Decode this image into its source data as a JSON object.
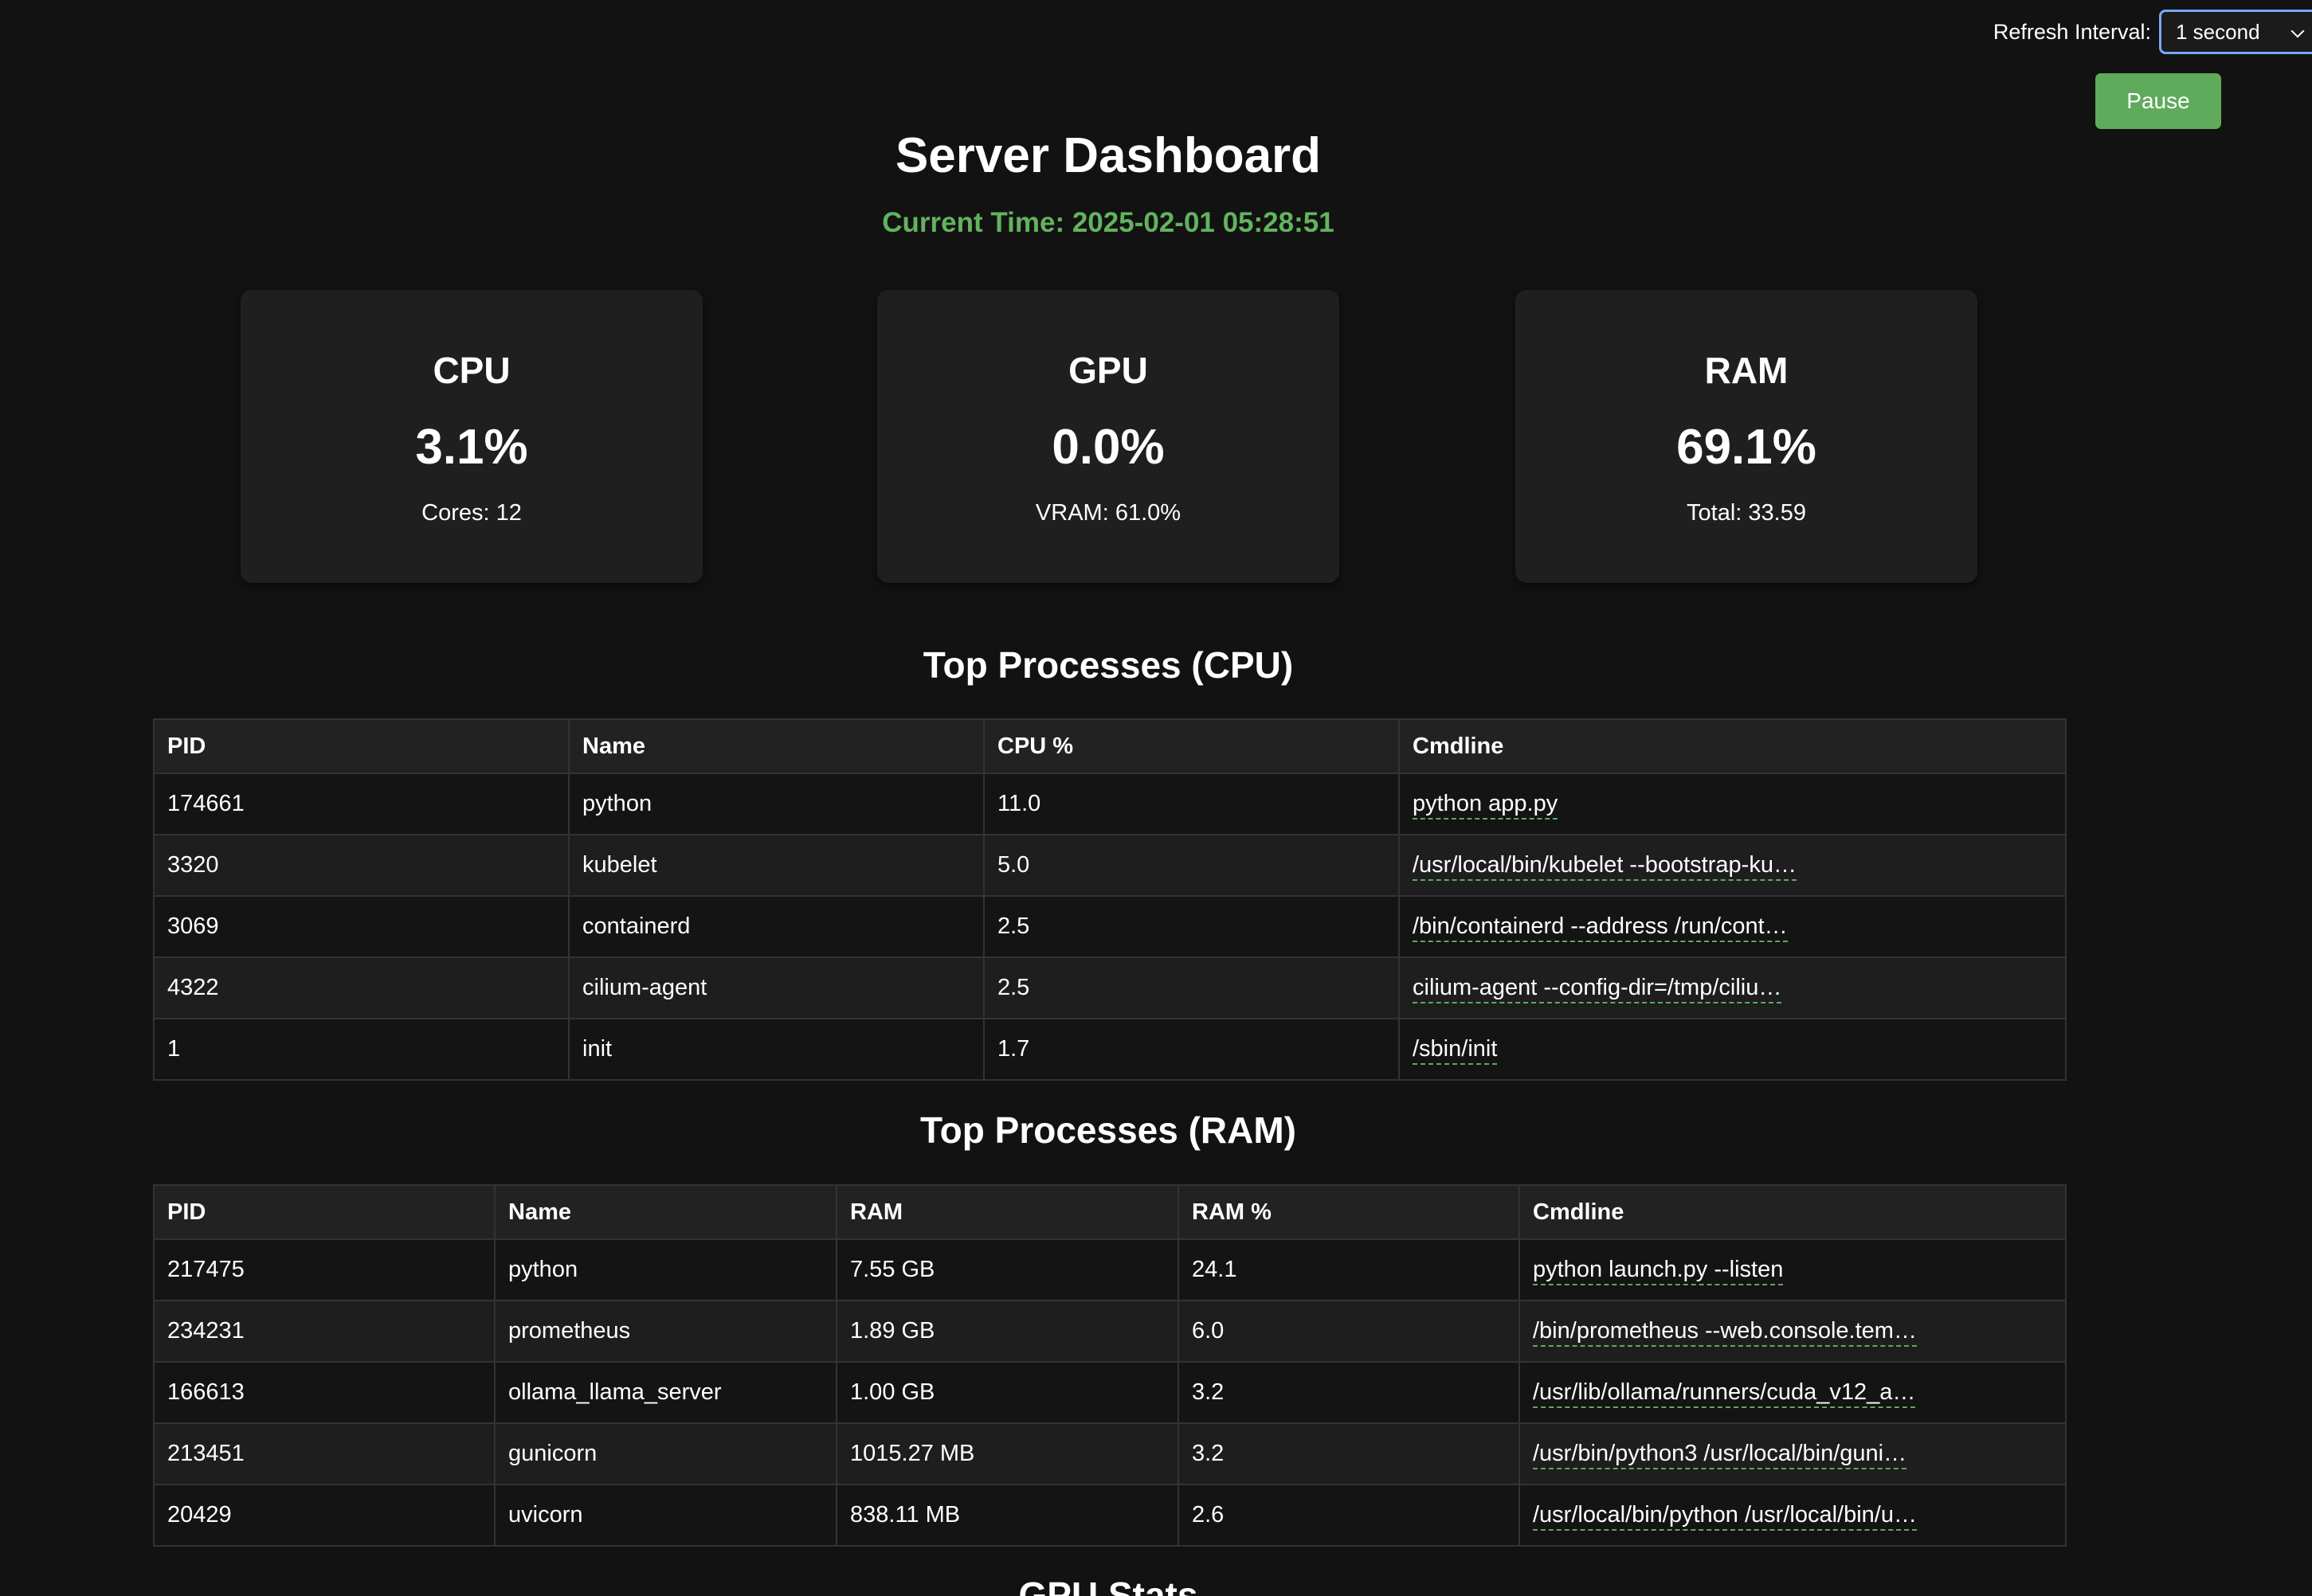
{
  "refresh": {
    "label": "Refresh Interval:",
    "selected": "1 second"
  },
  "pause_label": "Pause",
  "title": "Server Dashboard",
  "current_time": "Current Time: 2025-02-01 05:28:51",
  "cards": {
    "cpu": {
      "title": "CPU",
      "value": "3.1%",
      "sub": "Cores: 12"
    },
    "gpu": {
      "title": "GPU",
      "value": "0.0%",
      "sub": "VRAM: 61.0%"
    },
    "ram": {
      "title": "RAM",
      "value": "69.1%",
      "sub": "Total: 33.59"
    }
  },
  "cpu_table": {
    "title": "Top Processes (CPU)",
    "headers": [
      "PID",
      "Name",
      "CPU %",
      "Cmdline"
    ],
    "rows": [
      [
        "174661",
        "python",
        "11.0",
        "python app.py"
      ],
      [
        "3320",
        "kubelet",
        "5.0",
        "/usr/local/bin/kubelet --bootstrap-ku…"
      ],
      [
        "3069",
        "containerd",
        "2.5",
        "/bin/containerd --address /run/cont…"
      ],
      [
        "4322",
        "cilium-agent",
        "2.5",
        "cilium-agent --config-dir=/tmp/ciliu…"
      ],
      [
        "1",
        "init",
        "1.7",
        "/sbin/init"
      ]
    ]
  },
  "ram_table": {
    "title": "Top Processes (RAM)",
    "headers": [
      "PID",
      "Name",
      "RAM",
      "RAM %",
      "Cmdline"
    ],
    "rows": [
      [
        "217475",
        "python",
        "7.55 GB",
        "24.1",
        "python launch.py --listen"
      ],
      [
        "234231",
        "prometheus",
        "1.89 GB",
        "6.0",
        "/bin/prometheus --web.console.tem…"
      ],
      [
        "166613",
        "ollama_llama_server",
        "1.00 GB",
        "3.2",
        "/usr/lib/ollama/runners/cuda_v12_a…"
      ],
      [
        "213451",
        "gunicorn",
        "1015.27 MB",
        "3.2",
        "/usr/bin/python3 /usr/local/bin/guni…"
      ],
      [
        "20429",
        "uvicorn",
        "838.11 MB",
        "2.6",
        "/usr/local/bin/python /usr/local/bin/u…"
      ]
    ]
  },
  "gpu_stats_title": "GPU Stats"
}
